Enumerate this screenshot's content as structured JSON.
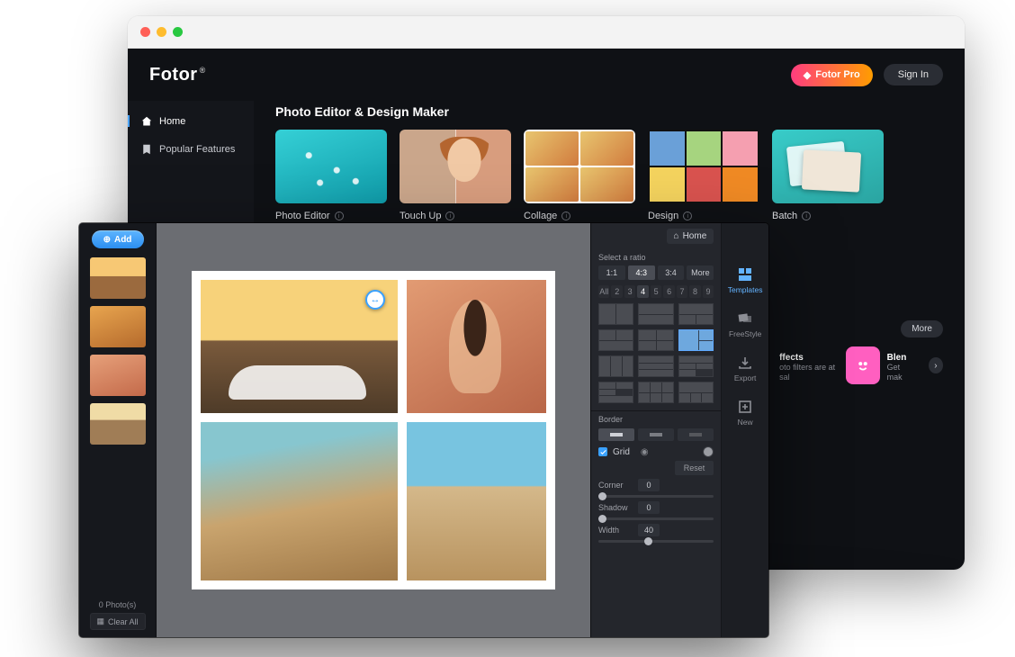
{
  "app": {
    "brand": "Fotor",
    "pro_button": "Fotor Pro",
    "signin_button": "Sign In"
  },
  "sidebar": {
    "items": [
      {
        "label": "Home",
        "icon": "home-icon",
        "active": true
      },
      {
        "label": "Popular Features",
        "icon": "bookmark-icon",
        "active": false
      }
    ]
  },
  "home": {
    "section_title": "Photo Editor & Design Maker",
    "cards": [
      {
        "label": "Photo Editor"
      },
      {
        "label": "Touch Up"
      },
      {
        "label": "Collage"
      },
      {
        "label": "Design"
      },
      {
        "label": "Batch"
      }
    ],
    "more_button": "More",
    "feature_strip": [
      {
        "title": "ffects",
        "subtitle": "oto filters are at\nsal",
        "icon": "star-icon",
        "color": "blue"
      },
      {
        "title": "Blen",
        "subtitle": "Get\nmak",
        "icon": "face-icon",
        "color": "pink"
      }
    ]
  },
  "editor": {
    "add_button": "Add",
    "thumbnails": 4,
    "photos_count": "0 Photo(s)",
    "clear_all": "Clear All",
    "home_button": "Home",
    "ratio": {
      "label": "Select a ratio",
      "options": [
        "1:1",
        "4:3",
        "3:4",
        "More"
      ],
      "selected": "4:3"
    },
    "count": {
      "options": [
        "All",
        "2",
        "3",
        "4",
        "5",
        "6",
        "7",
        "8",
        "9"
      ],
      "selected": "4"
    },
    "layouts": {
      "count": 12,
      "selected_index": 5
    },
    "border": {
      "label": "Border",
      "grid_label": "Grid",
      "grid_checked": true,
      "reset_button": "Reset",
      "sliders": [
        {
          "label": "Corner",
          "value": 0,
          "pos": 0
        },
        {
          "label": "Shadow",
          "value": 0,
          "pos": 0
        },
        {
          "label": "Width",
          "value": 40,
          "pos": 40
        }
      ]
    },
    "rail": [
      {
        "label": "Templates",
        "active": true
      },
      {
        "label": "FreeStyle",
        "active": false
      },
      {
        "label": "Export",
        "active": false
      },
      {
        "label": "New",
        "active": false
      }
    ]
  }
}
